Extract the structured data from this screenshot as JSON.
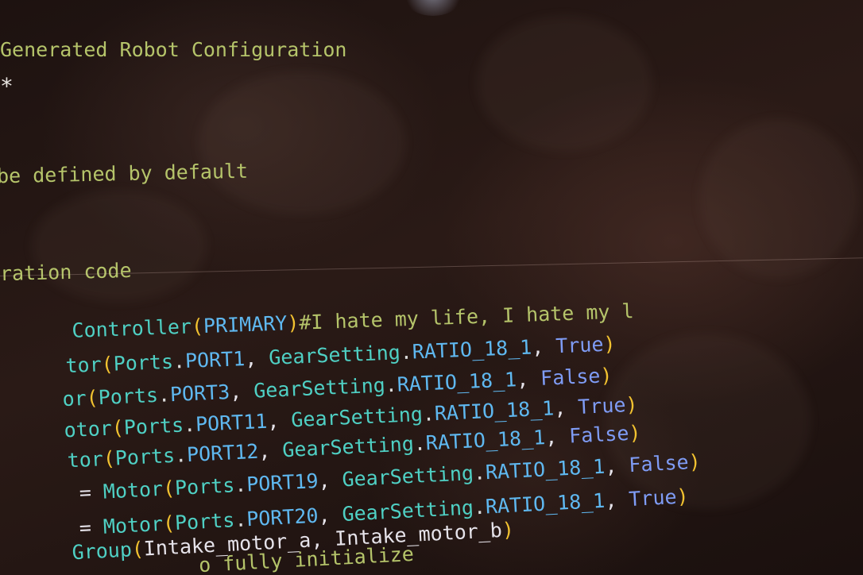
{
  "code_lines": {
    "l1": {
      "text": "Generated Robot Configuration"
    },
    "l2": {
      "text": "*"
    },
    "l3": {
      "text": "be defined by default"
    },
    "l4": {
      "text": "ration code"
    },
    "l5": {
      "a": "Controller",
      "b": "(",
      "c": "PRIMARY",
      "d": ")",
      "e": "#I hate my life, I hate my l"
    },
    "l6": {
      "a": "tor",
      "b": "(",
      "c": "Ports",
      "d": ".",
      "e": "PORT1",
      "f": ", ",
      "g": "GearSetting",
      "h": ".",
      "i": "RATIO_18_1",
      "j": ", ",
      "k": "True",
      "l": ")"
    },
    "l7": {
      "a": "or",
      "b": "(",
      "c": "Ports",
      "d": ".",
      "e": "PORT3",
      "f": ", ",
      "g": "GearSetting",
      "h": ".",
      "i": "RATIO_18_1",
      "j": ", ",
      "k": "False",
      "l": ")"
    },
    "l8": {
      "a": "otor",
      "b": "(",
      "c": "Ports",
      "d": ".",
      "e": "PORT11",
      "f": ", ",
      "g": "GearSetting",
      "h": ".",
      "i": "RATIO_18_1",
      "j": ", ",
      "k": "True",
      "l": ")"
    },
    "l9": {
      "a": "tor",
      "b": "(",
      "c": "Ports",
      "d": ".",
      "e": "PORT12",
      "f": ", ",
      "g": "GearSetting",
      "h": ".",
      "i": "RATIO_18_1",
      "j": ", ",
      "k": "False",
      "l": ")"
    },
    "l10": {
      "z": " = ",
      "a": "Motor",
      "b": "(",
      "c": "Ports",
      "d": ".",
      "e": "PORT19",
      "f": ", ",
      "g": "GearSetting",
      "h": ".",
      "i": "RATIO_18_1",
      "j": ", ",
      "k": "False",
      "l": ")"
    },
    "l11": {
      "z": " = ",
      "a": "Motor",
      "b": "(",
      "c": "Ports",
      "d": ".",
      "e": "PORT20",
      "f": ", ",
      "g": "GearSetting",
      "h": ".",
      "i": "RATIO_18_1",
      "j": ", ",
      "k": "True",
      "l": ")"
    },
    "l12": {
      "a": "Group",
      "b": "(",
      "c": "Intake_motor_a, Intake_motor_b",
      "d": ")"
    },
    "l13": {
      "text": "o fully initialize"
    }
  }
}
